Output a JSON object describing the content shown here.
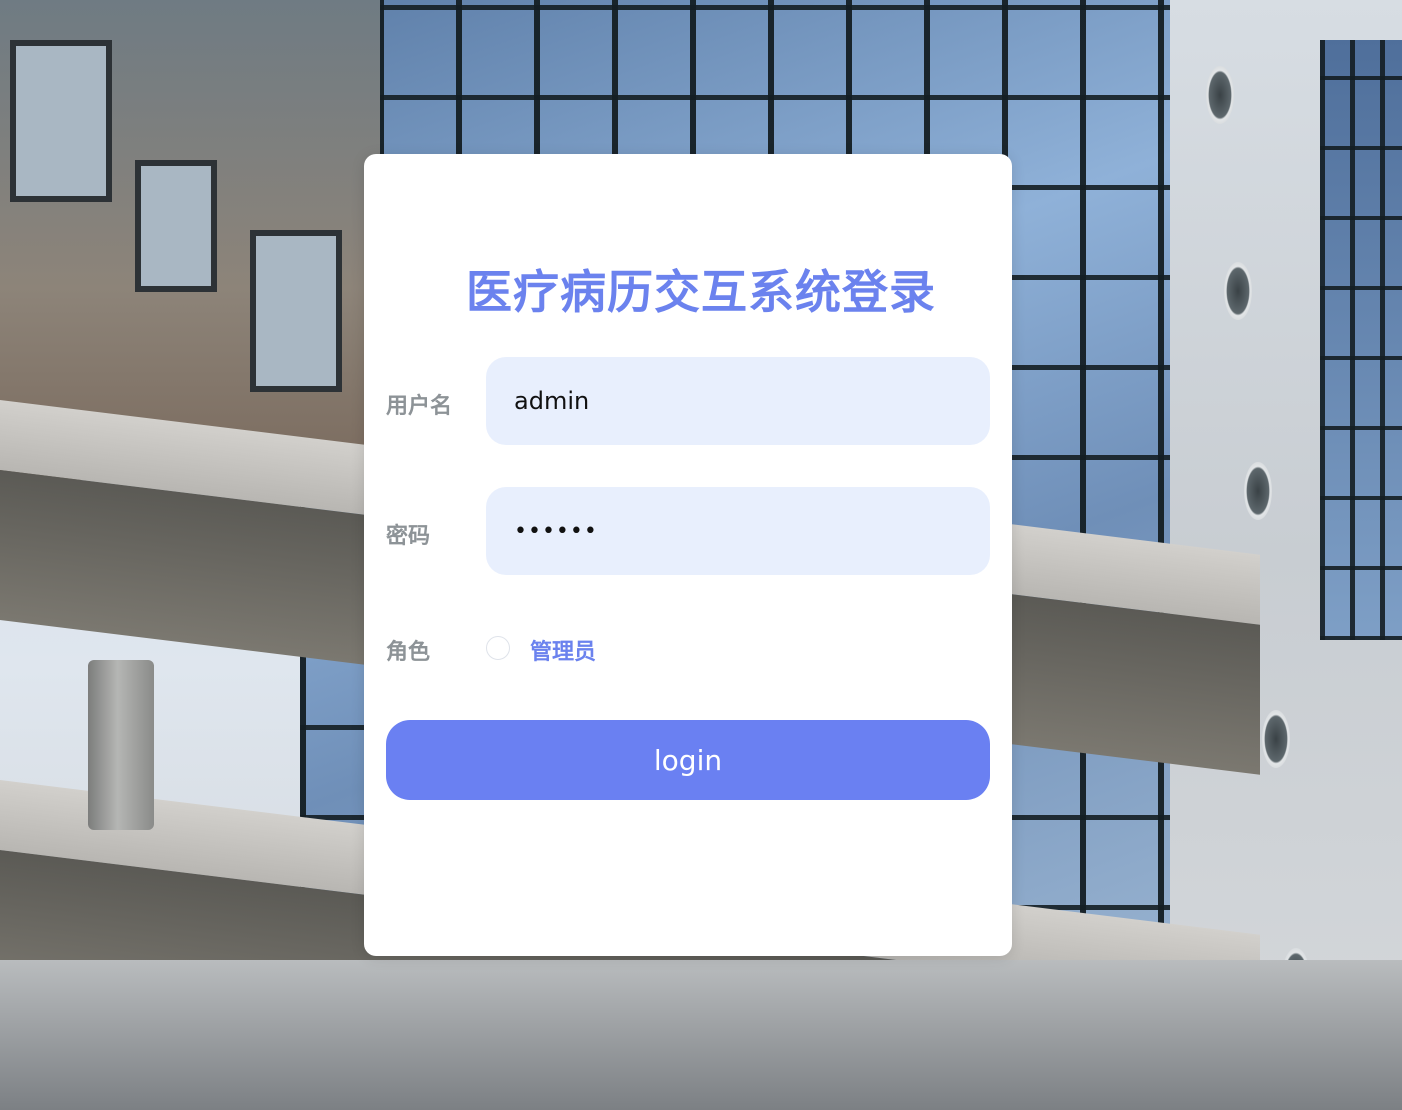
{
  "login": {
    "title": "医疗病历交互系统登录",
    "username": {
      "label": "用户名",
      "value": "admin"
    },
    "password": {
      "label": "密码",
      "masked_value": "••••••"
    },
    "role": {
      "label": "角色",
      "options": [
        "管理员"
      ]
    },
    "submit_label": "login"
  },
  "colors": {
    "accent": "#6b82ee",
    "button": "#6a80f2",
    "input_background": "#e8effd",
    "label_gray": "#8d9397"
  }
}
